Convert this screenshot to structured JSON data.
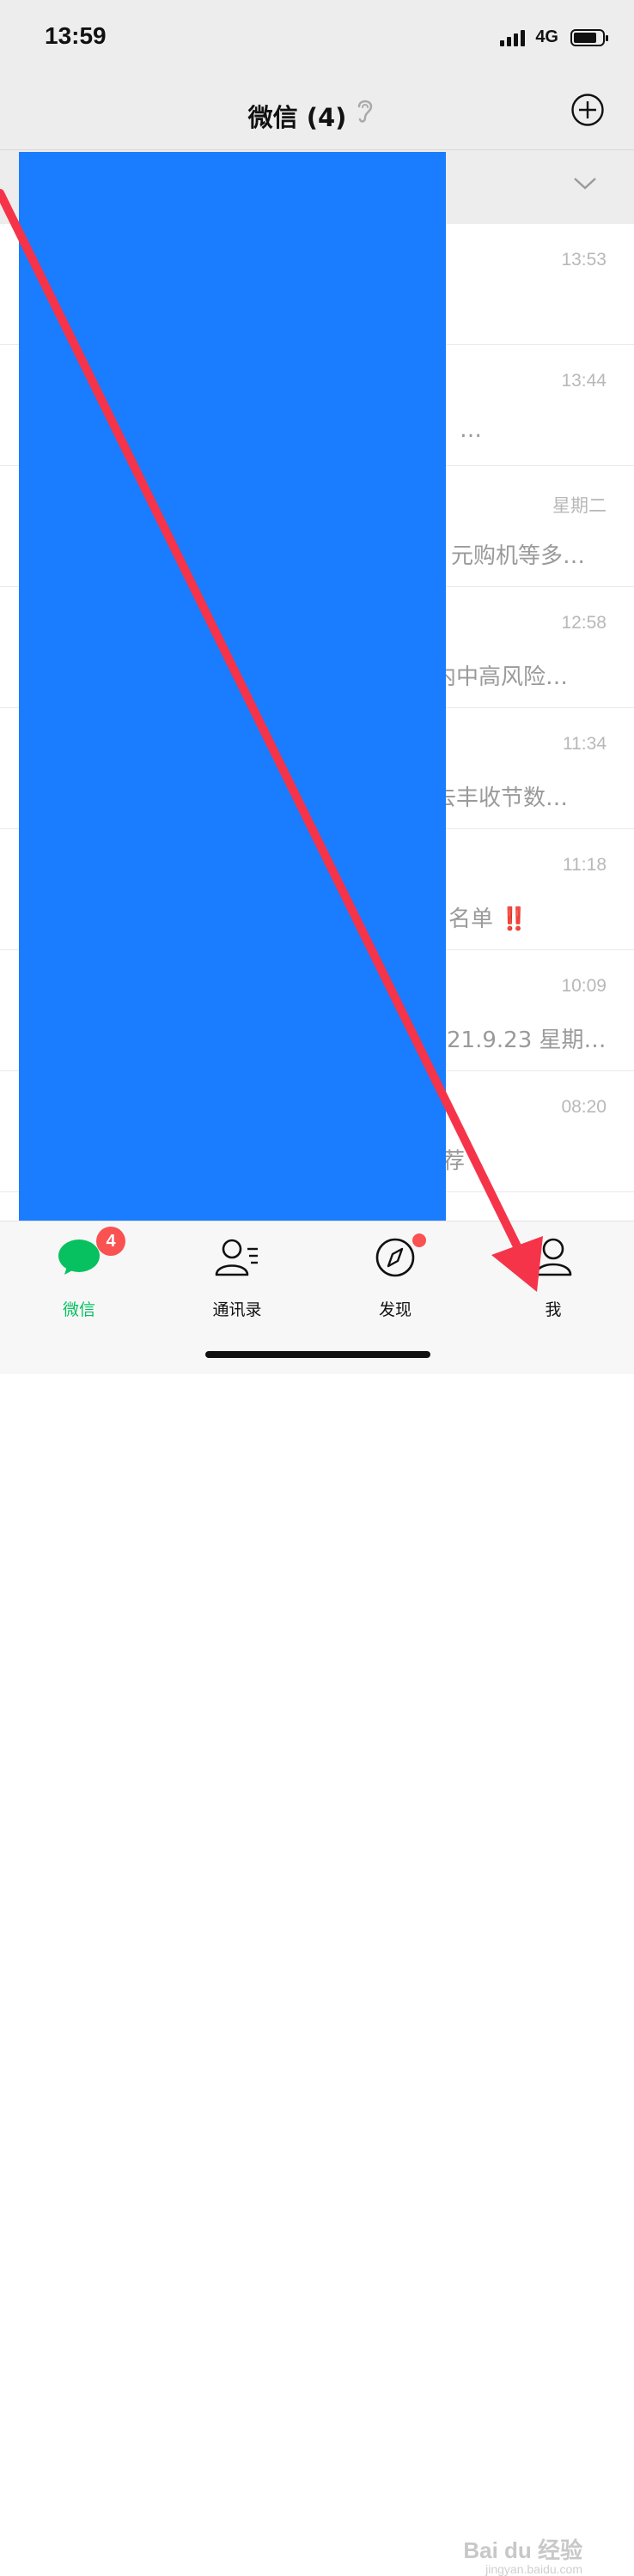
{
  "status_bar": {
    "time": "13:59",
    "network": "4G"
  },
  "nav": {
    "title": "微信 (4)"
  },
  "chats": [
    {
      "time": "13:53",
      "preview": ""
    },
    {
      "time": "13:44",
      "preview": "…"
    },
    {
      "time": "星期二",
      "preview": "元购机等多…"
    },
    {
      "time": "12:58",
      "preview": "内中高风险…"
    },
    {
      "time": "11:34",
      "preview": "去丰收节数…"
    },
    {
      "time": "11:18",
      "preview": "名单 ‼️"
    },
    {
      "time": "10:09",
      "preview": "21.9.23 星期…"
    },
    {
      "time": "08:20",
      "preview": "荐"
    }
  ],
  "tabs": [
    {
      "label": "微信",
      "badge": "4"
    },
    {
      "label": "通讯录"
    },
    {
      "label": "发现"
    },
    {
      "label": "我"
    }
  ],
  "watermark": {
    "text": "Bai du 经验",
    "sub": "jingyan.baidu.com"
  },
  "colors": {
    "accent": "#07c160",
    "badge": "#fa5151",
    "redaction": "#1a7cff",
    "arrow": "#f5344a"
  }
}
